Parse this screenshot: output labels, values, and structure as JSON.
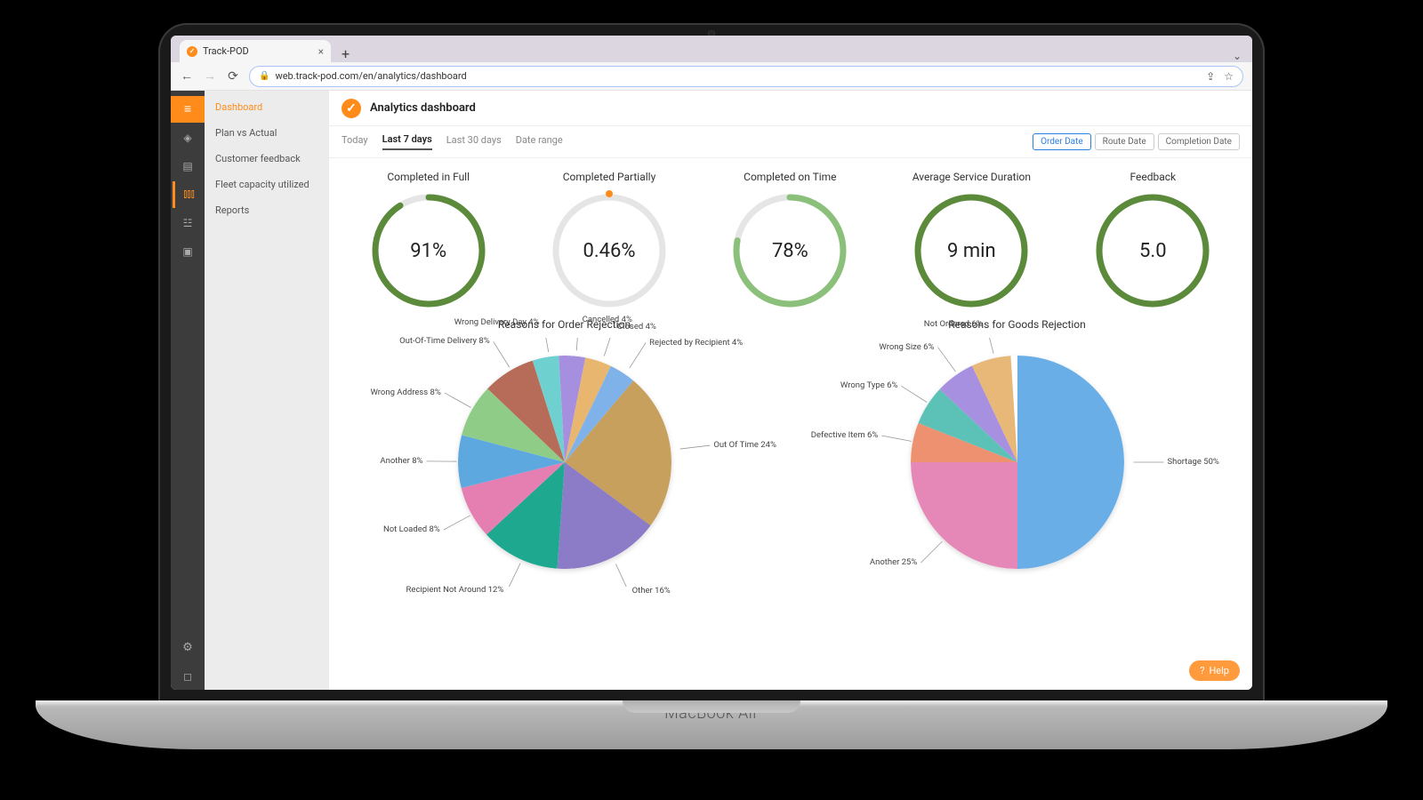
{
  "browser": {
    "tab_title": "Track-POD",
    "url": "web.track-pod.com/en/analytics/dashboard"
  },
  "sidebar": {
    "items": [
      "Dashboard",
      "Plan vs Actual",
      "Customer feedback",
      "Fleet capacity utilized",
      "Reports"
    ]
  },
  "header": {
    "title": "Analytics dashboard"
  },
  "range_tabs": [
    "Today",
    "Last 7 days",
    "Last 30 days",
    "Date range"
  ],
  "date_pills": [
    "Order Date",
    "Route Date",
    "Completion Date"
  ],
  "gauges": [
    {
      "title": "Completed in Full",
      "value": "91%",
      "percent": 91,
      "color": "#5a8a3a"
    },
    {
      "title": "Completed Partially",
      "value": "0.46%",
      "percent": 0.46,
      "color": "#ff8c1a"
    },
    {
      "title": "Completed on Time",
      "value": "78%",
      "percent": 78,
      "color": "#8bc07a"
    },
    {
      "title": "Average Service Duration",
      "value": "9 min",
      "percent": 100,
      "color": "#5a8a3a"
    },
    {
      "title": "Feedback",
      "value": "5.0",
      "percent": 100,
      "color": "#5a8a3a"
    }
  ],
  "help_label": "Help",
  "laptop_brand": "MacBook Air",
  "chart_data": [
    {
      "type": "pie",
      "title": "Reasons for Order Rejection",
      "series": [
        {
          "name": "Out Of Time",
          "value": 24,
          "color": "#c6a05c"
        },
        {
          "name": "Other",
          "value": 16,
          "color": "#8c7bc7"
        },
        {
          "name": "Recipient Not Around",
          "value": 12,
          "color": "#1fa890"
        },
        {
          "name": "Not Loaded",
          "value": 8,
          "color": "#e57fb1"
        },
        {
          "name": "Another",
          "value": 8,
          "color": "#5ea8e0"
        },
        {
          "name": "Wrong Address",
          "value": 8,
          "color": "#8fcc87"
        },
        {
          "name": "Out-Of-Time Delivery",
          "value": 8,
          "color": "#b76c5a"
        },
        {
          "name": "Wrong Delivery Day",
          "value": 4,
          "color": "#6fd0d0"
        },
        {
          "name": "Cancelled",
          "value": 4,
          "color": "#a78fe0"
        },
        {
          "name": "Closed",
          "value": 4,
          "color": "#e8b66f"
        },
        {
          "name": "Rejected by Recipient",
          "value": 4,
          "color": "#7fb2e8"
        }
      ]
    },
    {
      "type": "pie",
      "title": "Reasons for Goods Rejection",
      "series": [
        {
          "name": "Shortage",
          "value": 50,
          "color": "#6aaee8"
        },
        {
          "name": "Another",
          "value": 25,
          "color": "#e588b8"
        },
        {
          "name": "Defective Item",
          "value": 6,
          "color": "#ed9170"
        },
        {
          "name": "Wrong Type",
          "value": 6,
          "color": "#5cc2b8"
        },
        {
          "name": "Wrong Size",
          "value": 6,
          "color": "#a890e0"
        },
        {
          "name": "Not Ordered",
          "value": 6,
          "color": "#e8b878"
        }
      ]
    }
  ]
}
